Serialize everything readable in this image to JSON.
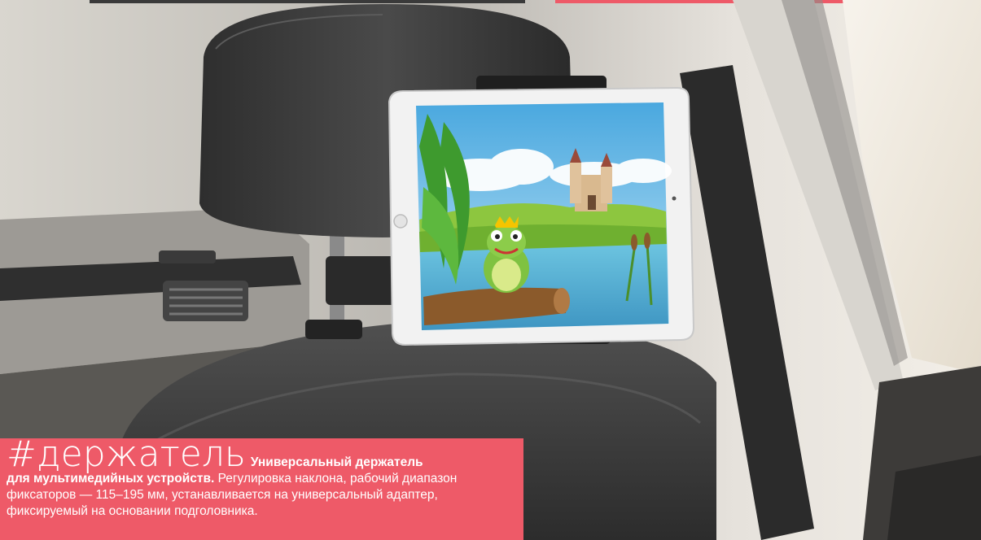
{
  "caption": {
    "hashtag": "#держатель",
    "lead_part1": "Универсальный держатель",
    "lead_part2": "для мультимедийных устройств.",
    "description": "Регулировка наклона, рабочий диапазон фиксаторов — 115–195 мм, устанавливается на универсальный адаптер, фиксируемый на основании подголовника."
  },
  "colors": {
    "caption_bg": "#ee5a68",
    "caption_text": "#ffffff",
    "headrest": "#3a3a3a",
    "sky": "#7ec6ec",
    "grass": "#8dc63f",
    "water": "#5bb8d8"
  },
  "icons": [
    "tablet-home-button-icon",
    "tablet-camera-icon"
  ]
}
